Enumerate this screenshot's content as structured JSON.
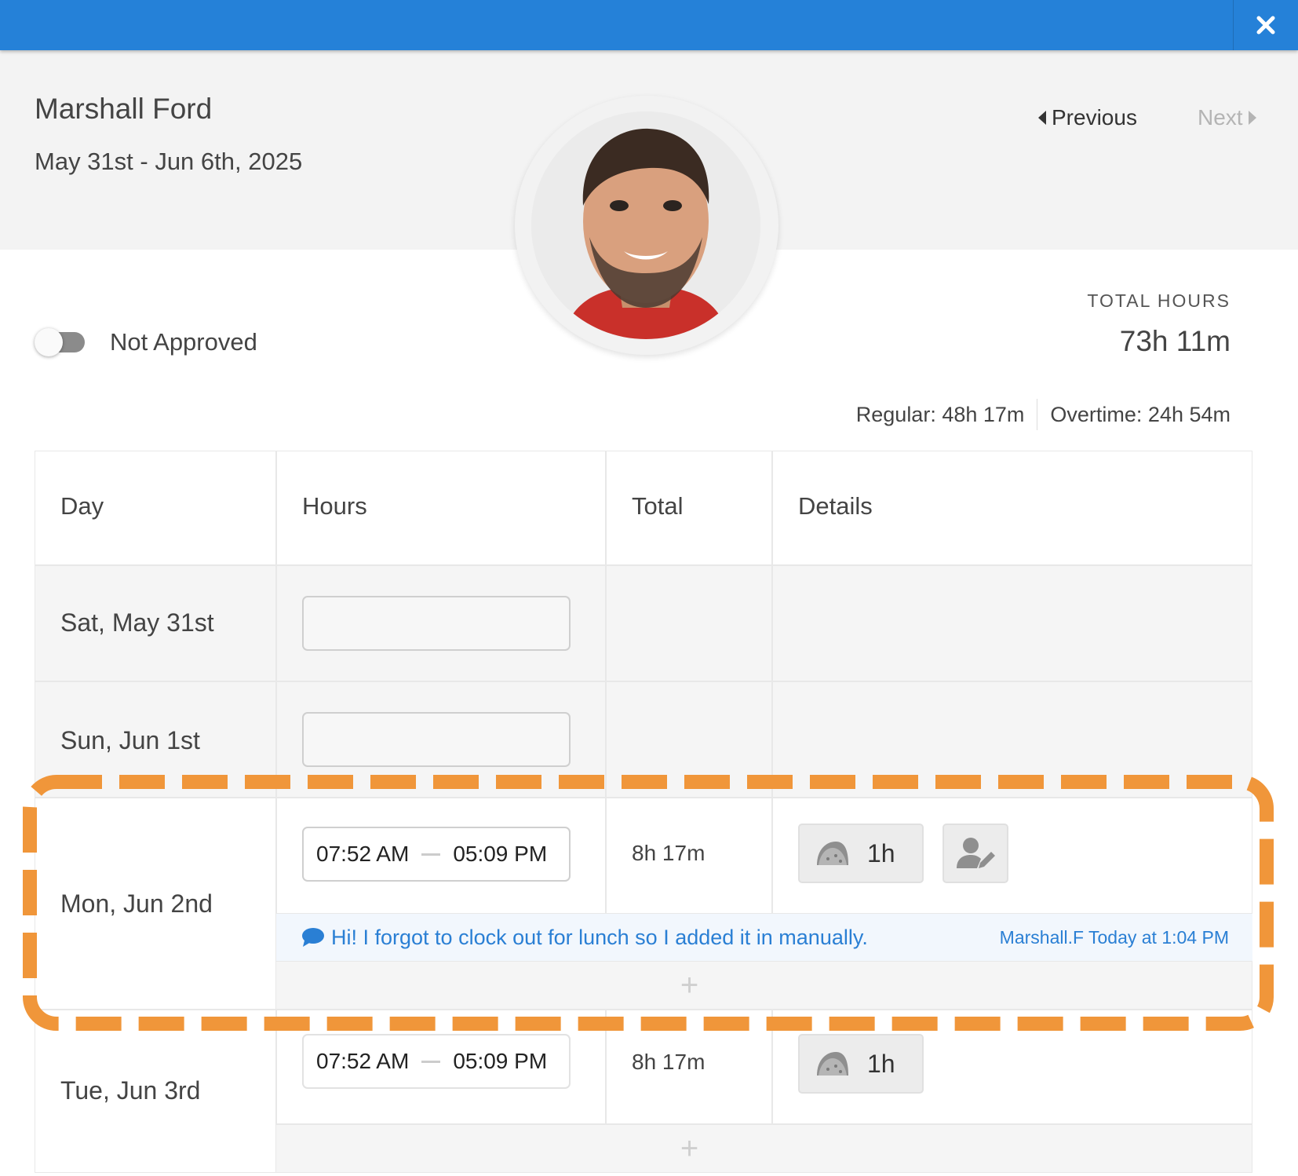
{
  "header": {
    "employee_name": "Marshall Ford",
    "date_range": "May 31st - Jun 6th, 2025",
    "previous_label": "Previous",
    "next_label": "Next"
  },
  "status": {
    "approval_label": "Not Approved",
    "approved": false
  },
  "summary": {
    "total_hours_label": "TOTAL HOURS",
    "total_hours_value": "73h 11m",
    "regular": "Regular: 48h 17m",
    "overtime": "Overtime: 24h 54m"
  },
  "table": {
    "columns": [
      "Day",
      "Hours",
      "Total",
      "Details"
    ],
    "rows": [
      {
        "day": "Sat, May 31st"
      },
      {
        "day": "Sun, Jun 1st"
      },
      {
        "day": "Mon, Jun 2nd",
        "start": "07:52 AM",
        "end": "05:09 PM",
        "total": "8h 17m",
        "break": "1h",
        "note": "Hi! I forgot to clock out for lunch so I added it in manually.",
        "note_meta": "Marshall.F Today at 1:04 PM"
      },
      {
        "day": "Tue, Jun 3rd",
        "start": "07:52 AM",
        "end": "05:09 PM",
        "total": "8h 17m",
        "break": "1h"
      }
    ]
  },
  "colors": {
    "topbar": "#2581d8",
    "highlight": "#f0963a",
    "note": "#2a7fd4"
  },
  "icons": [
    "close-icon",
    "chevron-left-icon",
    "chevron-right-icon",
    "taco-icon",
    "user-edit-icon",
    "chat-bubble-icon",
    "plus-icon"
  ]
}
